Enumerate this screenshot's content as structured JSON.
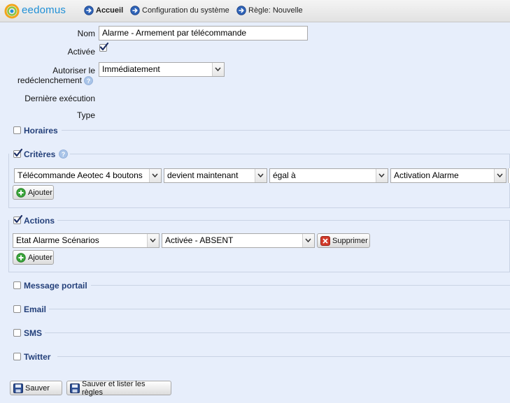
{
  "brand": {
    "name": "eedomus"
  },
  "breadcrumbs": [
    {
      "label": "Accueil"
    },
    {
      "label": "Configuration du système"
    },
    {
      "label": "Règle: Nouvelle"
    }
  ],
  "form": {
    "nom_label": "Nom",
    "nom_value": "Alarme - Armement par télécommande",
    "activee_label": "Activée",
    "activee_checked": true,
    "redecl_label_line1": "Autoriser le",
    "redecl_label_line2": "redéclenchement",
    "redecl_value": "Immédiatement",
    "derniere_label": "Dernière exécution",
    "type_label": "Type"
  },
  "sections": {
    "horaires": {
      "title": "Horaires",
      "checked": false
    },
    "criteres": {
      "title": "Critères",
      "checked": true,
      "row": {
        "device": "Télécommande Aeotec 4 boutons",
        "condition": "devient maintenant",
        "operator": "égal à",
        "value": "Activation Alarme"
      },
      "add_label": "Ajouter"
    },
    "actions": {
      "title": "Actions",
      "checked": true,
      "row": {
        "device": "Etat Alarme Scénarios",
        "value": "Activée - ABSENT",
        "delete_label": "Supprimer"
      },
      "add_label": "Ajouter"
    },
    "message_portail": {
      "title": "Message portail",
      "checked": false
    },
    "email": {
      "title": "Email",
      "checked": false
    },
    "sms": {
      "title": "SMS",
      "checked": false
    },
    "twitter": {
      "title": "Twitter",
      "checked": false
    }
  },
  "footer": {
    "save_label": "Sauver",
    "save_list_label": "Sauver et lister les règles"
  },
  "colors": {
    "panel_bg": "#e7eefb",
    "section_title": "#24407a",
    "brand": "#1f8fd6",
    "add_icon": "#3aa53a",
    "delete_icon": "#d23b2b"
  },
  "icons": {
    "logo": "eedomus-ring-logo",
    "crumb": "blue-arrow-circle-icon",
    "help": "help-question-icon",
    "add": "green-plus-icon",
    "delete": "red-x-icon",
    "save": "floppy-disk-icon"
  }
}
